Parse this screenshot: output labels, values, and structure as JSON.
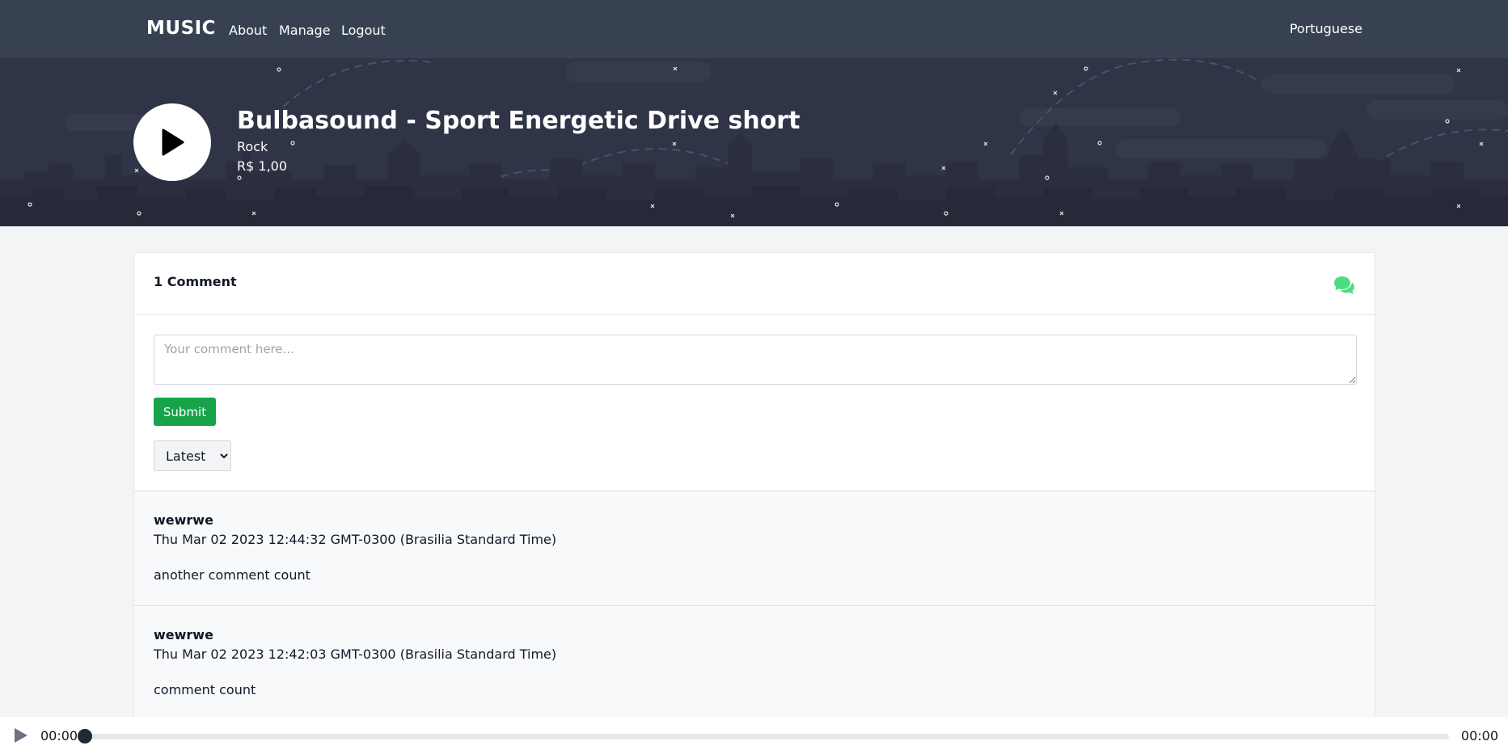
{
  "nav": {
    "brand": "MUSIC",
    "links": [
      "About",
      "Manage",
      "Logout"
    ],
    "language": "Portuguese"
  },
  "song": {
    "title": "Bulbasound - Sport Energetic Drive short",
    "genre": "Rock",
    "price": "R$ 1,00"
  },
  "comments": {
    "count_label": "1 Comment",
    "placeholder": "Your comment here...",
    "submit_label": "Submit",
    "sort_options": [
      "Latest"
    ],
    "sort_selected": "Latest",
    "items": [
      {
        "author": "wewrwe",
        "date": "Thu Mar 02 2023 12:44:32 GMT-0300 (Brasilia Standard Time)",
        "text": "another comment count"
      },
      {
        "author": "wewrwe",
        "date": "Thu Mar 02 2023 12:42:03 GMT-0300 (Brasilia Standard Time)",
        "text": "comment count"
      }
    ]
  },
  "player": {
    "current_time": "00:00",
    "duration": "00:00",
    "progress": 0
  },
  "colors": {
    "nav_bg": "#374151",
    "hero_bg": "#2f3446",
    "accent_green": "#16a34a",
    "icon_green": "#4ade80"
  }
}
